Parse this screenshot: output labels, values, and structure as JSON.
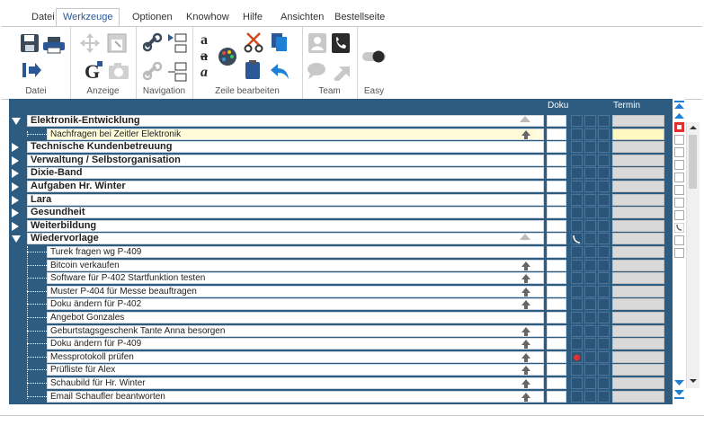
{
  "menu": {
    "tabs": [
      "Datei",
      "Werkzeuge",
      "Optionen",
      "Knowhow",
      "Hilfe",
      "Ansichten",
      "Bestellseite"
    ],
    "active_index": 1
  },
  "ribbon": {
    "groups": [
      "Datei",
      "Anzeige",
      "Navigation",
      "Zeile bearbeiten",
      "Team",
      "Easy"
    ],
    "icons": {
      "datei": [
        "save-icon",
        "print-icon",
        "exit-icon"
      ],
      "anzeige": [
        "move-icon",
        "window-icon",
        "font-g-icon",
        "camera-icon"
      ],
      "navigation": [
        "link-icon",
        "tree-expand-icon",
        "link-gray-icon",
        "tree-collapse-icon"
      ],
      "zeile": [
        "font-a-icon",
        "font-b-icon",
        "palette-icon",
        "cut-icon",
        "copy-icon",
        "paste-icon",
        "undo-icon"
      ],
      "team": [
        "contact-icon",
        "phone-icon",
        "chat-icon",
        "arrow-icon"
      ],
      "easy": [
        "toggle-icon"
      ]
    },
    "colors": {
      "accent": "#2b5797",
      "cut": "#d04a1f"
    }
  },
  "table": {
    "headers": {
      "doku": "Doku",
      "termin": "Termin"
    },
    "rows": [
      {
        "type": "category",
        "label": "Elektronik-Entwicklung",
        "expanded": true,
        "arrow": "outline"
      },
      {
        "type": "item",
        "label": "Nachfragen bei Zeitler Elektronik",
        "arrow": "solid",
        "highlight": true
      },
      {
        "type": "category",
        "label": "Technische Kundenbetreuung",
        "expanded": false
      },
      {
        "type": "category",
        "label": "Verwaltung / Selbstorganisation",
        "expanded": false
      },
      {
        "type": "category",
        "label": "Dixie-Band",
        "expanded": false
      },
      {
        "type": "category",
        "label": "Aufgaben Hr. Winter",
        "expanded": false
      },
      {
        "type": "category",
        "label": "Lara",
        "expanded": false
      },
      {
        "type": "category",
        "label": "Gesundheit",
        "expanded": false
      },
      {
        "type": "category",
        "label": "Weiterbildung",
        "expanded": false
      },
      {
        "type": "category",
        "label": "Wiedervorlage",
        "expanded": true,
        "arrow": "outline",
        "mark": "phone"
      },
      {
        "type": "item",
        "label": "Turek fragen wg P-409"
      },
      {
        "type": "item",
        "label": "Bitcoin verkaufen",
        "arrow": "solid"
      },
      {
        "type": "item",
        "label": "Software für P-402 Startfunktion testen",
        "arrow": "solid"
      },
      {
        "type": "item",
        "label": "Muster P-404 für Messe beauftragen",
        "arrow": "solid"
      },
      {
        "type": "item",
        "label": "Doku ändern für P-402",
        "arrow": "solid"
      },
      {
        "type": "item",
        "label": "Angebot Gonzales"
      },
      {
        "type": "item",
        "label": "Geburtstagsgeschenk Tante Anna besorgen",
        "arrow": "solid"
      },
      {
        "type": "item",
        "label": "Doku ändern für P-409",
        "arrow": "solid"
      },
      {
        "type": "item",
        "label": "Messprotokoll prüfen",
        "arrow": "solid",
        "mark": "red"
      },
      {
        "type": "item",
        "label": "Prüfliste für Alex",
        "arrow": "solid"
      },
      {
        "type": "item",
        "label": "Schaubild für Hr. Winter",
        "arrow": "solid"
      },
      {
        "type": "item",
        "label": "Email Schaufler beantworten",
        "arrow": "solid"
      }
    ]
  },
  "side": {
    "colors": {
      "blue": "#1e7fd6",
      "red": "#e03030"
    }
  }
}
